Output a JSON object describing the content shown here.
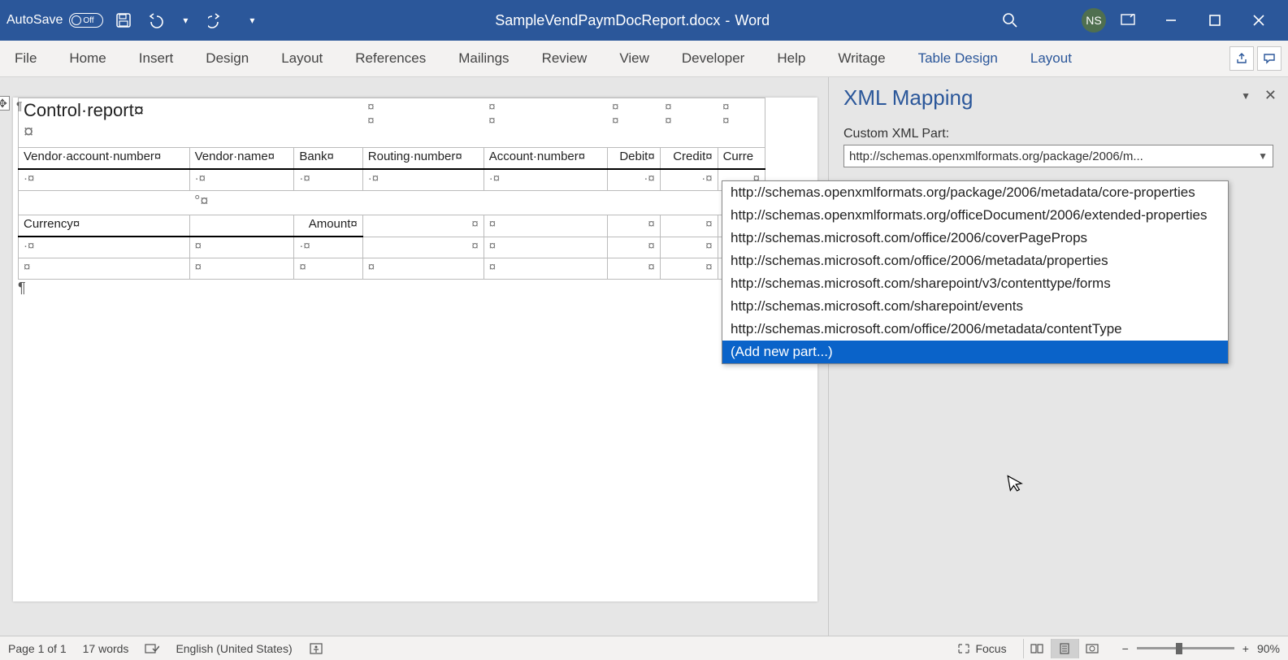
{
  "titlebar": {
    "autosave_label": "AutoSave",
    "autosave_state": "Off",
    "doc_name": "SampleVendPaymDocReport.docx",
    "app_name": "Word",
    "user_initials": "NS"
  },
  "ribbon": {
    "tabs": [
      "File",
      "Home",
      "Insert",
      "Design",
      "Layout",
      "References",
      "Mailings",
      "Review",
      "View",
      "Developer",
      "Help",
      "Writage",
      "Table Design",
      "Layout"
    ],
    "active_tabs": [
      "Table Design",
      "Layout"
    ]
  },
  "xml_pane": {
    "title": "XML Mapping",
    "label": "Custom XML Part:",
    "selected": "http://schemas.openxmlformats.org/package/2006/m...",
    "options": [
      "http://schemas.openxmlformats.org/package/2006/metadata/core-properties",
      "http://schemas.openxmlformats.org/officeDocument/2006/extended-properties",
      "http://schemas.microsoft.com/office/2006/coverPageProps",
      "http://schemas.microsoft.com/office/2006/metadata/properties",
      "http://schemas.microsoft.com/sharepoint/v3/contenttype/forms",
      "http://schemas.microsoft.com/sharepoint/events",
      "http://schemas.microsoft.com/office/2006/metadata/contentType",
      "(Add new part...)"
    ],
    "highlight_index": 7
  },
  "document": {
    "title": "Control·report¤",
    "headers1": [
      "Vendor·account·number¤",
      "Vendor·name¤",
      "Bank¤",
      "Routing·number¤",
      "Account·number¤",
      "Debit¤",
      "Credit¤",
      "Curre"
    ],
    "headers2": [
      "Currency¤",
      "Amount¤"
    ],
    "cell_mark": "¤",
    "dot_mark": "·¤"
  },
  "statusbar": {
    "page": "Page 1 of 1",
    "words": "17 words",
    "lang": "English (United States)",
    "focus": "Focus",
    "zoom": "90%"
  }
}
